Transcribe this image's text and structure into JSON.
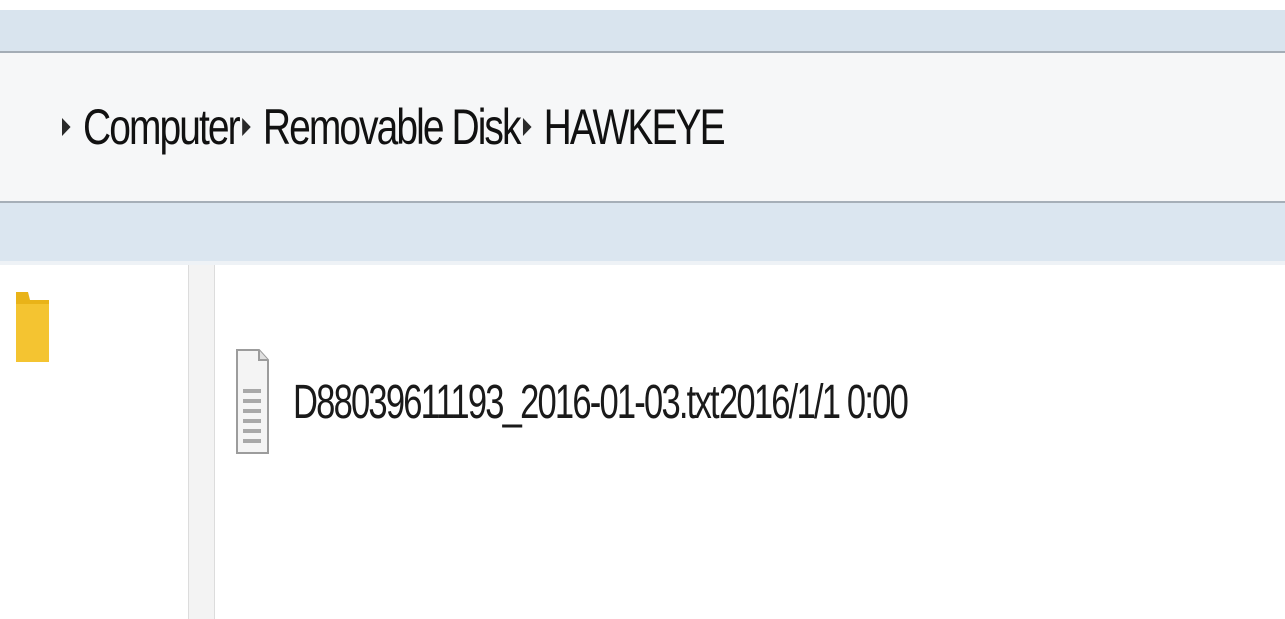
{
  "breadcrumb": {
    "items": [
      {
        "label": "Computer"
      },
      {
        "label": "Removable Disk"
      },
      {
        "label": "HAWKEYE"
      }
    ]
  },
  "navigation_pane": {
    "icon": "folder-icon",
    "icon_color": "#f2c12e"
  },
  "file_list": {
    "files": [
      {
        "name": "D88039611193_2016-01-03.txt",
        "date_modified": "2016/1/1 0:00",
        "icon": "text-file-icon"
      }
    ]
  },
  "colors": {
    "toolbar_band": "#d9e4ee",
    "address_bar": "#f6f7f8",
    "text": "#111111"
  }
}
